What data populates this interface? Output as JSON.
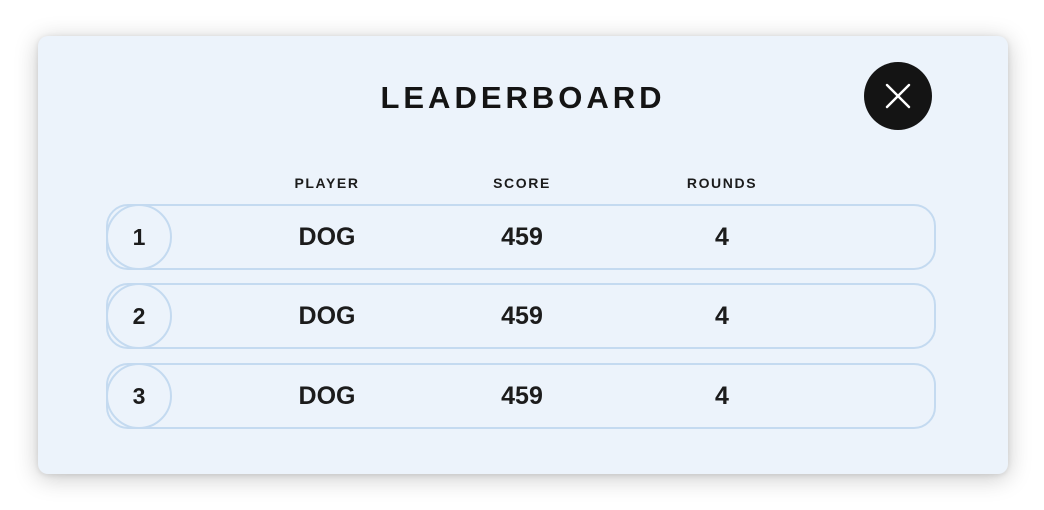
{
  "modal": {
    "title": "LEADERBOARD",
    "close_icon": "close-icon"
  },
  "columns": {
    "player": "PLAYER",
    "score": "SCORE",
    "rounds": "ROUNDS"
  },
  "rows": [
    {
      "rank": "1",
      "player": "DOG",
      "score": "459",
      "rounds": "4"
    },
    {
      "rank": "2",
      "player": "DOG",
      "score": "459",
      "rounds": "4"
    },
    {
      "rank": "3",
      "player": "DOG",
      "score": "459",
      "rounds": "4"
    }
  ],
  "colors": {
    "modal_background": "#ecf3fb",
    "row_border": "#c4daf0",
    "text": "#141414",
    "close_button": "#141414"
  }
}
